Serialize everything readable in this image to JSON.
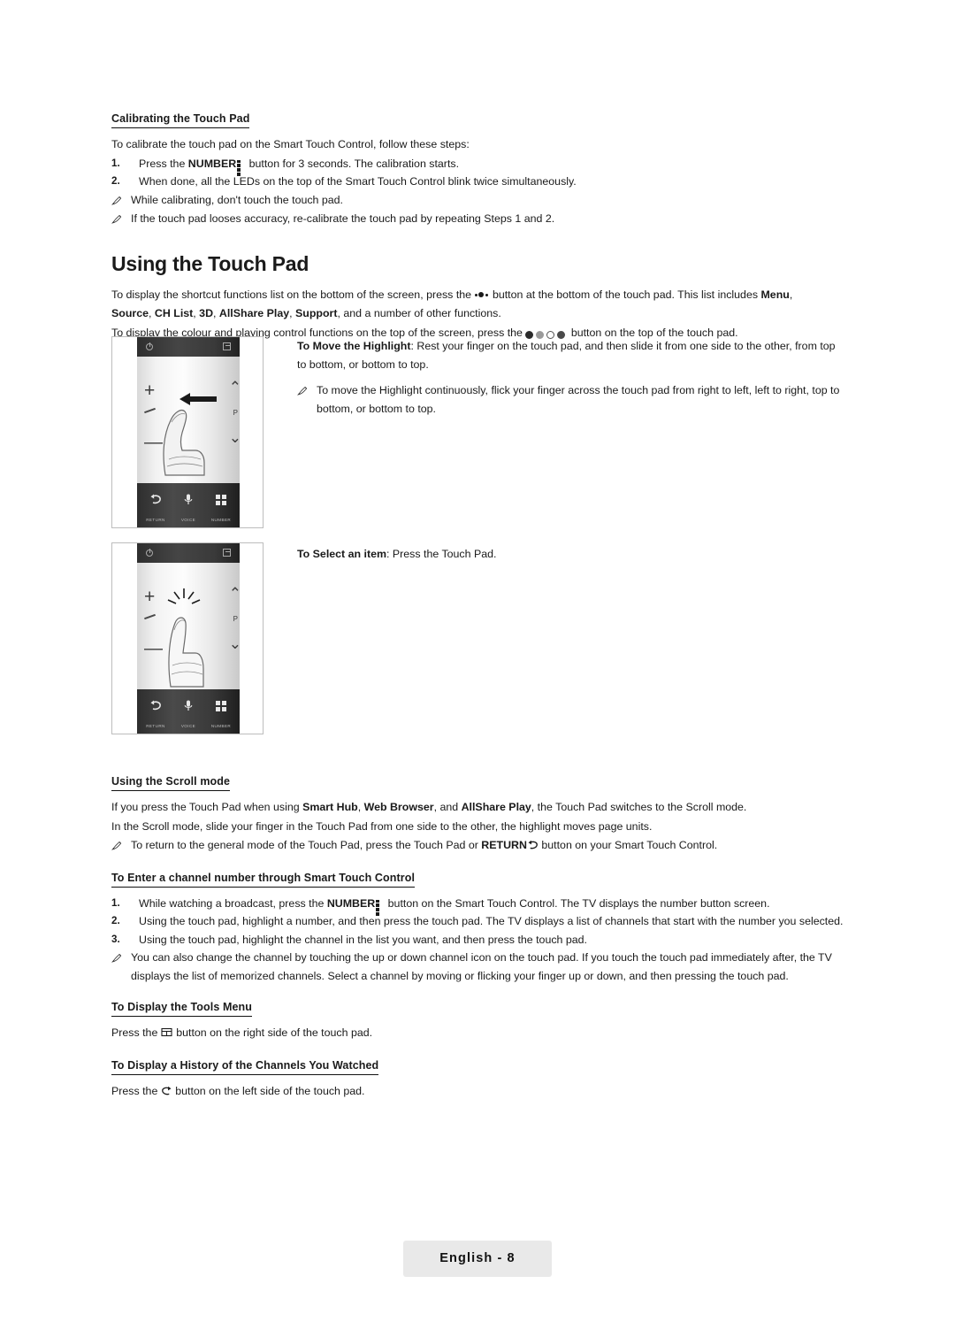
{
  "doc": {
    "footer_label": "English - 8"
  },
  "calibrating": {
    "heading": "Calibrating the Touch Pad",
    "intro": "To calibrate the touch pad on the Smart Touch Control, follow these steps:",
    "steps": [
      {
        "n": "1.",
        "pre": "Press the ",
        "bold": "NUMBER",
        "post": " button for 3 seconds. The calibration starts."
      },
      {
        "n": "2.",
        "pre": "When done, all the LEDs on the top of the Smart Touch Control blink twice simultaneously.",
        "bold": "",
        "post": ""
      }
    ],
    "notes": [
      "While calibrating, don't touch the touch pad.",
      "If the touch pad looses accuracy, re-calibrate the touch pad by repeating Steps 1 and 2."
    ]
  },
  "using_touch_pad": {
    "heading": "Using the Touch Pad",
    "p1_a": "To display the shortcut functions list on the bottom of the screen, press the ",
    "p1_b": " button at the bottom of the touch pad. This list includes ",
    "p1_menu": "Menu",
    "p1_c": ",",
    "p2_items": [
      "Source",
      "CH List",
      "3D",
      "AllShare Play",
      "Support"
    ],
    "p2_tail": ", and a number of other functions.",
    "p3_a": "To display the colour and playing control functions on the top of the screen, press the ",
    "p3_b": " button on the top of the touch pad.",
    "move_highlight": {
      "bold": "To Move the Highlight",
      "text": ": Rest your finger on the touch pad, and then slide it from one side to the other, from top to bottom, or bottom to top."
    },
    "move_note": "To move the Highlight continuously, flick your finger across the touch pad from right to left, left to right, top to bottom, or bottom to top.",
    "select_item": {
      "bold": "To Select an item",
      "text": ": Press the Touch Pad."
    }
  },
  "remote": {
    "button_labels": [
      "RETURN",
      "VOICE",
      "NUMBER"
    ],
    "icons": [
      "return-arrow-icon",
      "microphone-icon",
      "numpad-icon"
    ],
    "side_labels": {
      "plus": "+",
      "minus": "–",
      "p": "P"
    }
  },
  "scroll_mode": {
    "heading": "Using the Scroll mode",
    "p1_a": "If you press the Touch Pad when using ",
    "p1_b1": "Smart Hub",
    "p1_b2": "Web Browser",
    "p1_b3": "AllShare Play",
    "p1_mid1": ", ",
    "p1_mid2": ", and ",
    "p1_tail": ", the Touch Pad switches to the Scroll mode.",
    "p2": "In the Scroll mode, slide your finger in the Touch Pad from one side to the other, the highlight moves page units.",
    "note_a": "To return to the general mode of the Touch Pad, press the Touch Pad or ",
    "note_bold": "RETURN",
    "note_b": " button on your Smart Touch Control."
  },
  "channel_number": {
    "heading": "To Enter a channel number through Smart Touch Control",
    "steps": [
      {
        "n": "1.",
        "pre": "While watching a broadcast, press the ",
        "bold": "NUMBER",
        "post": " button on the Smart Touch Control. The TV displays the number button screen."
      },
      {
        "n": "2.",
        "pre": "Using the touch pad, highlight a number, and then press the touch pad. The TV displays a list of channels that start with the number you selected.",
        "bold": "",
        "post": ""
      },
      {
        "n": "3.",
        "pre": "Using the touch pad, highlight the channel in the list you want, and then press the touch pad.",
        "bold": "",
        "post": ""
      }
    ],
    "note": "You can also change the channel by touching the up or down channel icon on the touch pad. If you touch the touch pad immediately after, the TV displays the list of memorized channels. Select a channel by moving or flicking your finger up or down, and then pressing the touch pad."
  },
  "tools_menu": {
    "heading": "To Display the Tools Menu",
    "p_a": "Press the ",
    "p_b": " button on the right side of the touch pad."
  },
  "history": {
    "heading": "To Display a History of the Channels You Watched",
    "p_a": "Press the ",
    "p_b": " button on the left side of the touch pad."
  }
}
